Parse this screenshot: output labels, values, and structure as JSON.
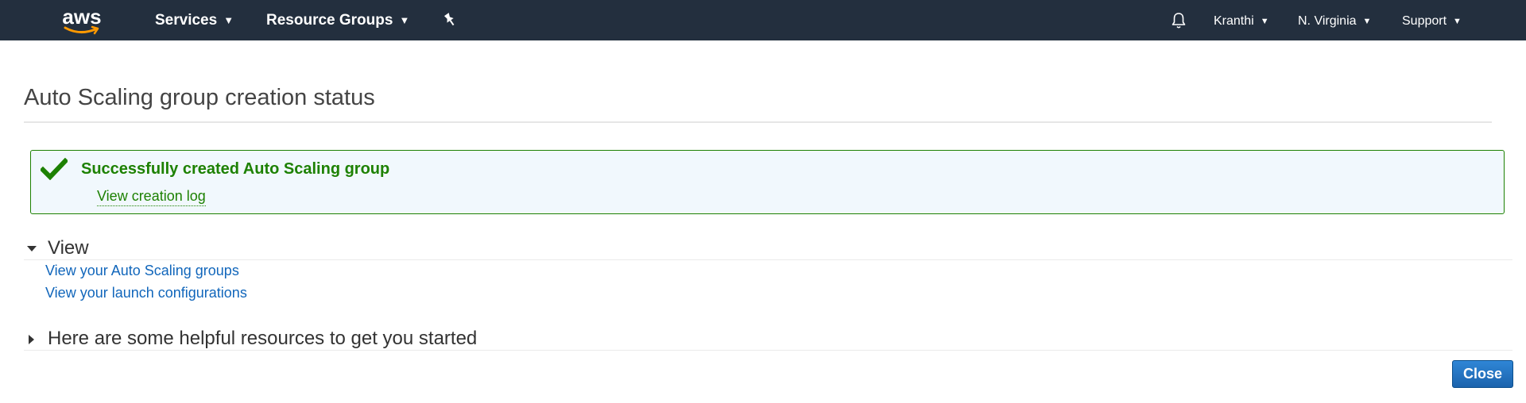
{
  "nav": {
    "logo_text": "aws",
    "services_label": "Services",
    "resource_groups_label": "Resource Groups",
    "pin_icon": "pin-icon",
    "bell_icon": "bell-icon",
    "user_label": "Kranthi",
    "region_label": "N. Virginia",
    "support_label": "Support",
    "background_color": "#232f3e"
  },
  "page": {
    "title": "Auto Scaling group creation status"
  },
  "alert": {
    "icon": "check-icon",
    "title": "Successfully created Auto Scaling group",
    "link": "View creation log",
    "color": "#1d8102"
  },
  "view_section": {
    "label": "View",
    "expanded": true,
    "links": [
      "View your Auto Scaling groups",
      "View your launch configurations"
    ]
  },
  "resources_section": {
    "label": "Here are some helpful resources to get you started",
    "expanded": false
  },
  "footer": {
    "close_label": "Close"
  }
}
